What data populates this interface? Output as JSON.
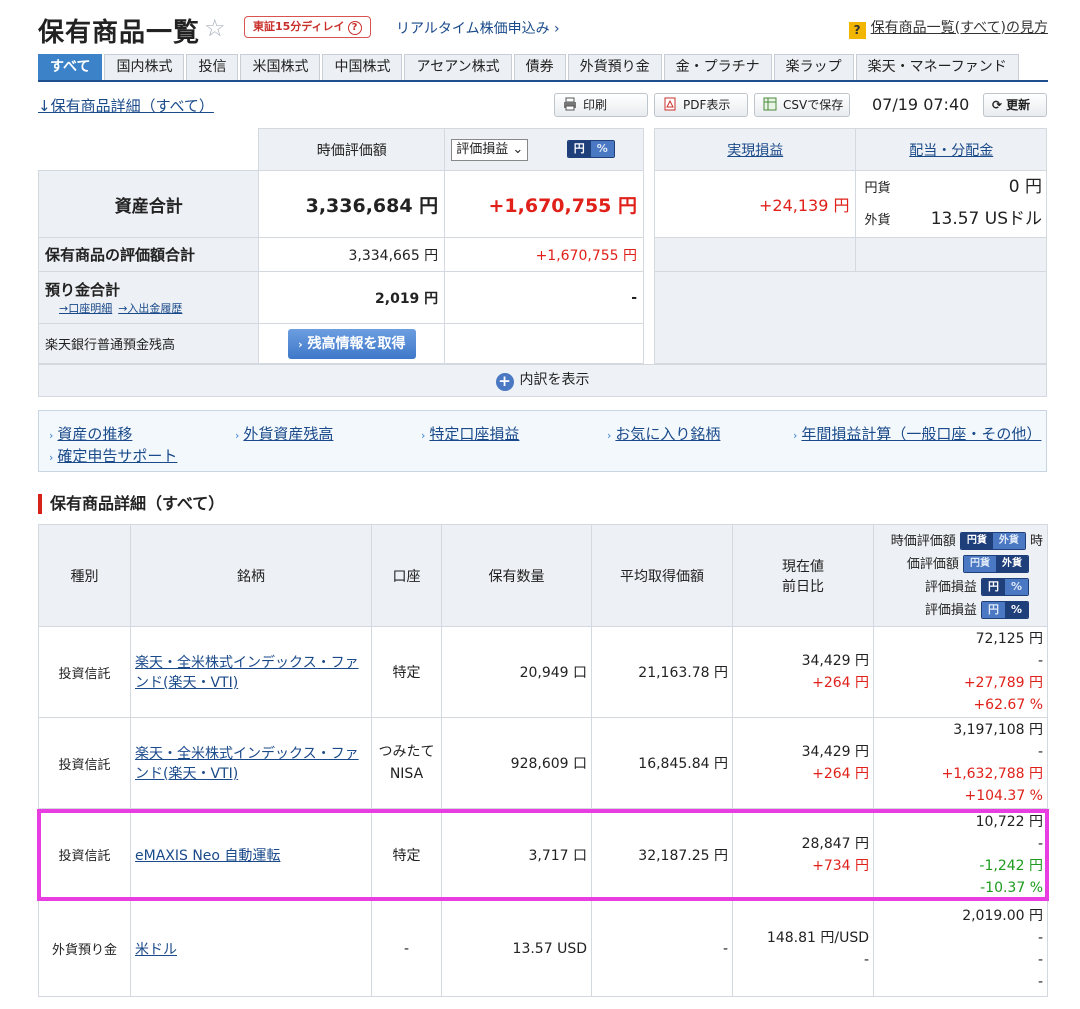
{
  "header": {
    "title": "保有商品一覧",
    "delay_badge": "東証15分ディレイ",
    "delay_q": "?",
    "realtime_link": "リアルタイム株価申込み",
    "help_link": "保有商品一覧(すべて)の見方"
  },
  "tabs": [
    "すべて",
    "国内株式",
    "投信",
    "米国株式",
    "中国株式",
    "アセアン株式",
    "債券",
    "外貨預り金",
    "金・プラチナ",
    "楽ラップ",
    "楽天・マネーファンド"
  ],
  "toolbar": {
    "detail_link": "↓保有商品詳細（すべて）",
    "print": "印刷",
    "pdf": "PDF表示",
    "csv": "CSVで保存",
    "timestamp": "07/19 07:40",
    "refresh": "更新"
  },
  "summary": {
    "col_market_value": "時価評価額",
    "select_value": "評価損益",
    "toggle_yen": "円",
    "toggle_pct": "%",
    "col_realized": "実現損益",
    "col_dividend": "配当・分配金",
    "total_label": "資産合計",
    "total_value": "3,336,684 円",
    "total_pl": "+1,670,755 円",
    "realized_value": "+24,139 円",
    "div_yen_label": "円貨",
    "div_yen_value": "0 円",
    "div_fx_label": "外貨",
    "div_fx_value": "13.57 USドル",
    "holdings_label": "保有商品の評価額合計",
    "holdings_value": "3,334,665 円",
    "holdings_pl": "+1,670,755 円",
    "deposit_label": "預り金合計",
    "deposit_link1": "→口座明細",
    "deposit_link2": "→入出金履歴",
    "deposit_value": "2,019 円",
    "deposit_pl": "-",
    "bank_label": "楽天銀行普通預金残高",
    "bank_button": "残高情報を取得",
    "expand": "内訳を表示"
  },
  "quick_links": [
    "資産の推移",
    "外貨資産残高",
    "特定口座損益",
    "お気に入り銘柄",
    "年間損益計算（一般口座・その他）",
    "確定申告サポート"
  ],
  "section_title": "保有商品詳細（すべて）",
  "holdings": {
    "headers": {
      "kind": "種別",
      "name": "銘柄",
      "account": "口座",
      "qty": "保有数量",
      "avg": "平均取得価額",
      "price1": "現在値",
      "price2": "前日比",
      "r1": "時価評価額",
      "r2": "価評価額",
      "r3": "評価損益",
      "r4": "評価損益",
      "r1_suffix": "時",
      "t_yenka": "円貨",
      "t_gaika": "外貨",
      "t_yen": "円",
      "t_pct": "%"
    },
    "rows": [
      {
        "kind": "投資信託",
        "name": "楽天・全米株式インデックス・ファンド(楽天・VTI)",
        "account": "特定",
        "qty": "20,949 口",
        "avg": "21,163.78 円",
        "price": "34,429 円",
        "change": "+264 円",
        "v1": "72,125 円",
        "v2": "-",
        "v3": "+27,789 円",
        "v4": "+62.67 %"
      },
      {
        "kind": "投資信託",
        "name": "楽天・全米株式インデックス・ファンド(楽天・VTI)",
        "account": "つみたて NISA",
        "qty": "928,609 口",
        "avg": "16,845.84 円",
        "price": "34,429 円",
        "change": "+264 円",
        "v1": "3,197,108 円",
        "v2": "-",
        "v3": "+1,632,788 円",
        "v4": "+104.37 %"
      },
      {
        "kind": "投資信託",
        "name": "eMAXIS Neo 自動運転",
        "account": "特定",
        "qty": "3,717 口",
        "avg": "32,187.25 円",
        "price": "28,847 円",
        "change": "+734 円",
        "v1": "10,722 円",
        "v2": "-",
        "v3": "-1,242 円",
        "v4": "-10.37 %"
      },
      {
        "kind": "外貨預り金",
        "name": "米ドル",
        "account": "-",
        "qty": "13.57 USD",
        "avg": "-",
        "price": "148.81 円/USD",
        "change": "-",
        "v1": "2,019.00 円",
        "v2": "-",
        "v3": "-",
        "v4": "-"
      }
    ]
  }
}
